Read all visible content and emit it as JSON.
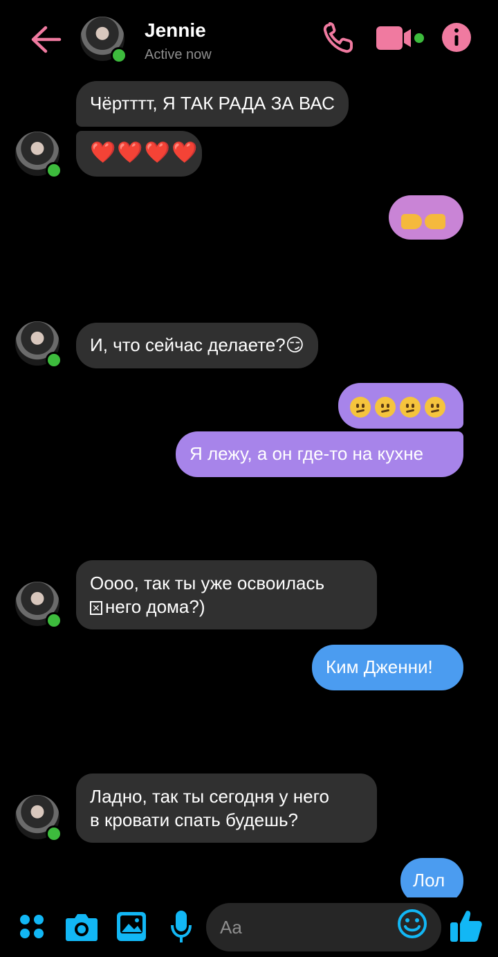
{
  "header": {
    "name": "Jennie",
    "status": "Active now",
    "icons": [
      "back-arrow-icon",
      "phone-icon",
      "video-camera-icon",
      "info-icon"
    ],
    "accent_color": "#f07aa0"
  },
  "messages": [
    {
      "from": "them",
      "text": "Чёртттт, Я ТАК РАДА ЗА ВАС"
    },
    {
      "from": "them",
      "text": "❤️❤️❤️❤️"
    },
    {
      "from": "me",
      "text": "👉👈"
    },
    {
      "from": "them",
      "text": "И, что сейчас делаете?😏"
    },
    {
      "from": "me",
      "text": "😕😕😕😕"
    },
    {
      "from": "me",
      "text": "Я лежу, а он где-то на кухне"
    },
    {
      "from": "them",
      "text_line1": "Оооо, так ты уже освоилась",
      "text_line2": "него дома?)"
    },
    {
      "from": "me",
      "text": "Ким Дженни!"
    },
    {
      "from": "them",
      "text_line1": "Ладно, так ты сегодня у него",
      "text_line2": "в кровати спать будешь?"
    },
    {
      "from": "me",
      "text": "Лол"
    }
  ],
  "composer": {
    "placeholder": "Aa",
    "icons": [
      "apps-icon",
      "camera-icon",
      "gallery-icon",
      "microphone-icon",
      "emoji-icon",
      "thumbs-up-icon"
    ],
    "icon_color": "#12b7f5"
  }
}
